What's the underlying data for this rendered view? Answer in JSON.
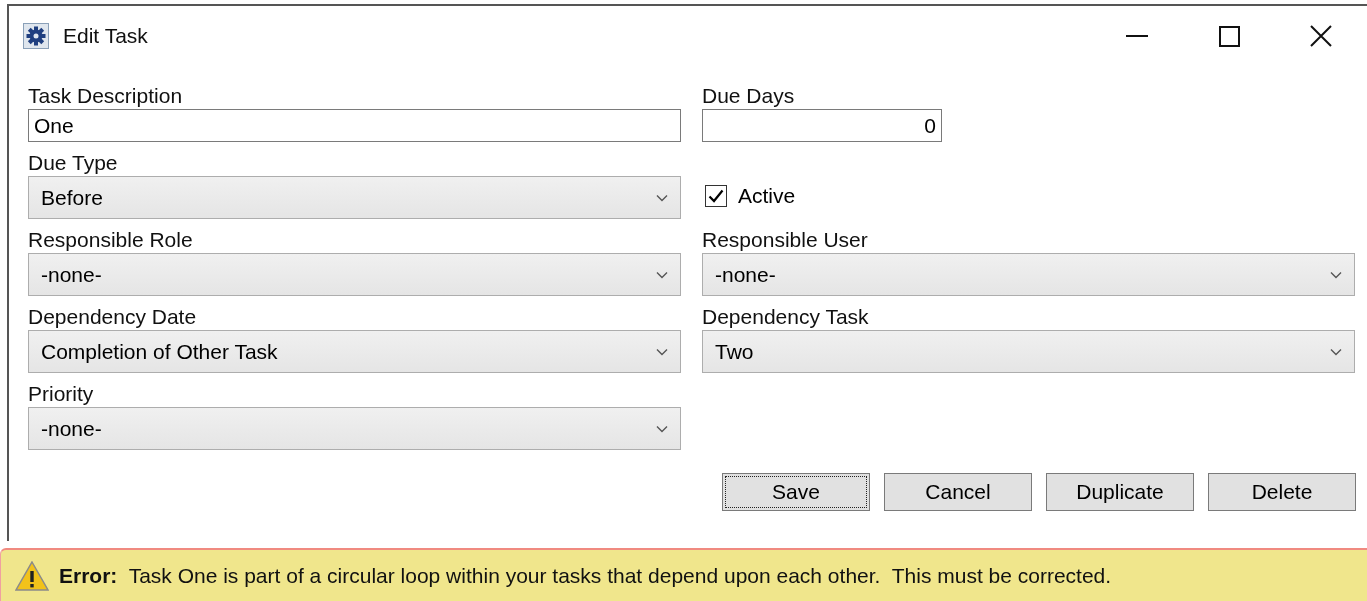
{
  "window": {
    "title": "Edit Task"
  },
  "rows": [
    [
      {
        "kind": "text",
        "label": "Task Description",
        "value": "One"
      },
      {
        "kind": "number",
        "label": "Due Days",
        "value": "0"
      }
    ],
    [
      {
        "kind": "select",
        "label": "Due Type",
        "value": "Before"
      },
      {
        "kind": "checkbox",
        "label": "Active",
        "checked": true
      }
    ],
    [
      {
        "kind": "select",
        "label": "Responsible Role",
        "value": "-none-"
      },
      {
        "kind": "select",
        "label": "Responsible User",
        "value": "-none-"
      }
    ],
    [
      {
        "kind": "select",
        "label": "Dependency Date",
        "value": "Completion of Other Task"
      },
      {
        "kind": "select",
        "label": "Dependency Task",
        "value": "Two"
      }
    ],
    [
      {
        "kind": "select",
        "label": "Priority",
        "value": "-none-"
      }
    ]
  ],
  "buttons": [
    {
      "label": "Save",
      "focused": true
    },
    {
      "label": "Cancel",
      "focused": false
    },
    {
      "label": "Duplicate",
      "focused": false
    },
    {
      "label": "Delete",
      "focused": false
    }
  ],
  "error": {
    "message": "**Error:**  Task One is part of a circular loop within your tasks that depend upon each other.  This must be corrected."
  }
}
